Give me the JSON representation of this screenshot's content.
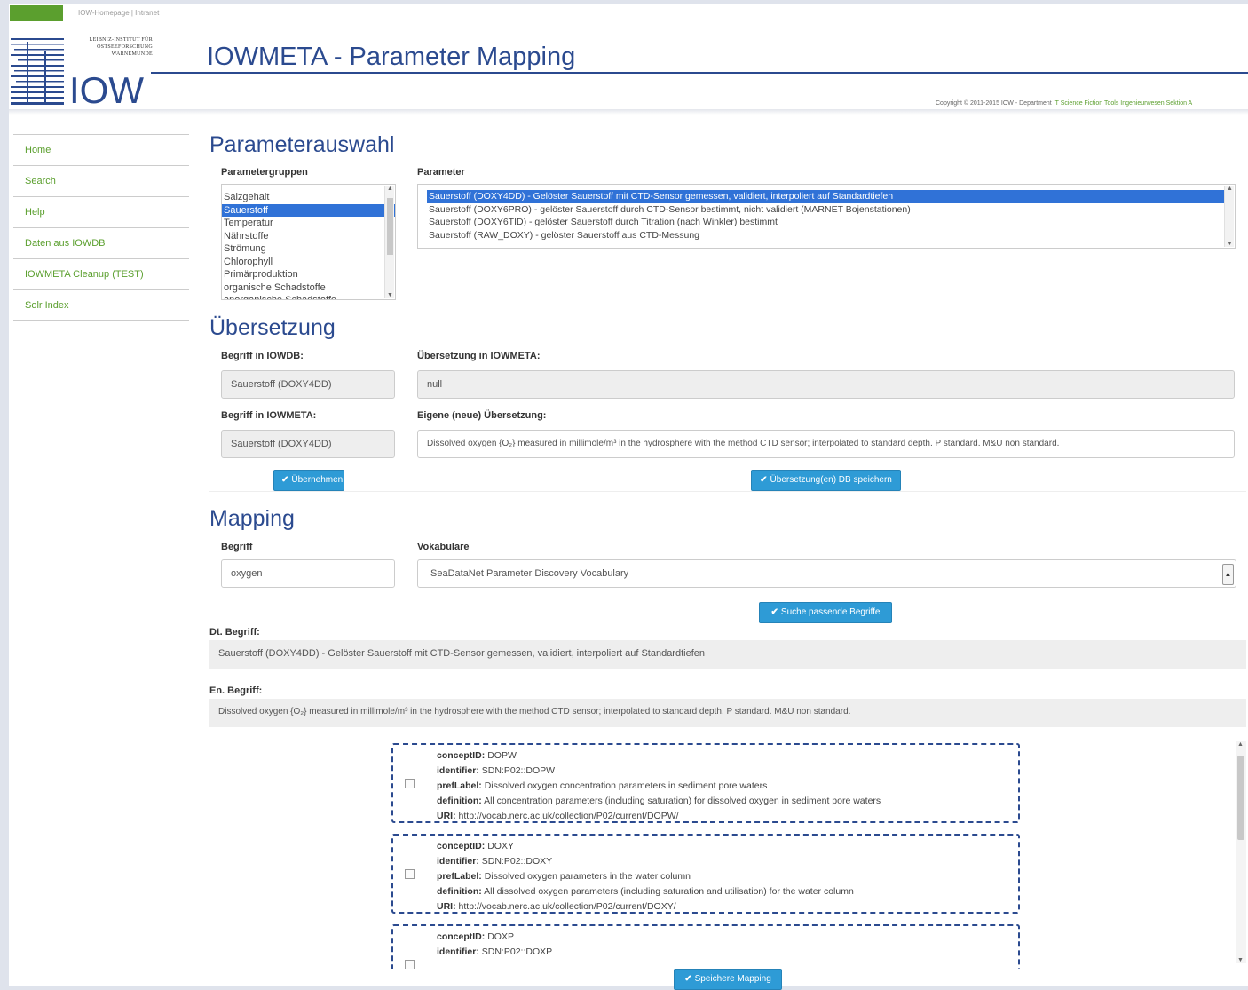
{
  "header": {
    "top_link": "IOW-Homepage | Intranet",
    "logo_lines": [
      "LEIBNIZ-INSTITUT FÜR",
      "OSTSEEFORSCHUNG",
      "WARNEMÜNDE"
    ],
    "logo_mark": "IOW",
    "title": "IOWMETA - Parameter Mapping",
    "copyright_prefix": "Copyright © 2011-2015 IOW - Department ",
    "copyright_links": "IT Science Fiction Tools Ingenieurwesen Sektion A"
  },
  "sidebar": {
    "items": [
      {
        "label": "Home"
      },
      {
        "label": "Search"
      },
      {
        "label": "Help"
      },
      {
        "label": "Daten aus IOWDB"
      },
      {
        "label": "IOWMETA Cleanup (TEST)"
      },
      {
        "label": "Solr Index"
      }
    ]
  },
  "parameterauswahl": {
    "heading": "Parameterauswahl",
    "groups_label": "Parametergruppen",
    "groups": [
      "Salzgehalt",
      "Sauerstoff",
      "Temperatur",
      "Nährstoffe",
      "Strömung",
      "Chlorophyll",
      "Primärproduktion",
      "organische Schadstoffe",
      "anorganische Schadstoffe"
    ],
    "groups_selected": "Sauerstoff",
    "params_label": "Parameter",
    "params": [
      "Sauerstoff (DOXY4DD) - Gelöster Sauerstoff mit CTD-Sensor gemessen, validiert, interpoliert auf Standardtiefen",
      "Sauerstoff (DOXY6PRO) - gelöster Sauerstoff durch CTD-Sensor bestimmt, nicht validiert (MARNET Bojenstationen)",
      "Sauerstoff (DOXY6TID) - gelöster Sauerstoff durch Titration (nach Winkler) bestimmt",
      "Sauerstoff (RAW_DOXY) - gelöster Sauerstoff aus CTD-Messung"
    ],
    "params_selected": "Sauerstoff (DOXY4DD) - Gelöster Sauerstoff mit CTD-Sensor gemessen, validiert, interpoliert auf Standardtiefen"
  },
  "uebersetzung": {
    "heading": "Übersetzung",
    "begriff_iowdb_label": "Begriff in IOWDB:",
    "begriff_iowdb_value": "Sauerstoff (DOXY4DD)",
    "uebersetzung_iowmeta_label": "Übersetzung in IOWMETA:",
    "uebersetzung_iowmeta_value": "null",
    "begriff_iowmeta_label": "Begriff in IOWMETA:",
    "begriff_iowmeta_value": "Sauerstoff (DOXY4DD)",
    "eigene_label": "Eigene (neue) Übersetzung:",
    "eigene_value": "Dissolved oxygen {O₂} measured in millimole/m³ in the hydrosphere with the method CTD sensor; interpolated to standard depth. P standard. M&U non standard.",
    "uebernehmen_button": "Übernehmen",
    "speichern_button": "Übersetzung(en) DB speichern"
  },
  "mapping": {
    "heading": "Mapping",
    "begriff_label": "Begriff",
    "begriff_value": "oxygen",
    "vokabulare_label": "Vokabulare",
    "vokabulare_selected": "SeaDataNet Parameter Discovery Vocabulary",
    "suche_button": "Suche passende Begriffe",
    "de_label": "Dt. Begriff:",
    "de_value": "Sauerstoff (DOXY4DD) - Gelöster Sauerstoff mit CTD-Sensor gemessen, validiert, interpoliert auf Standardtiefen",
    "en_label": "En. Begriff:",
    "en_value": "Dissolved oxygen {O₂} measured in millimole/m³ in the hydrosphere with the method CTD sensor; interpolated to standard depth. P standard. M&U non standard.",
    "save_button": "Speichere Mapping",
    "results": [
      {
        "conceptID": "DOPW",
        "identifier": "SDN:P02::DOPW",
        "prefLabel": "Dissolved oxygen concentration parameters in sediment pore waters",
        "definition": "All concentration parameters (including saturation) for dissolved oxygen in sediment pore waters",
        "URI": "http://vocab.nerc.ac.uk/collection/P02/current/DOPW/"
      },
      {
        "conceptID": "DOXY",
        "identifier": "SDN:P02::DOXY",
        "prefLabel": "Dissolved oxygen parameters in the water column",
        "definition": "All dissolved oxygen parameters (including saturation and utilisation) for the water column",
        "URI": "http://vocab.nerc.ac.uk/collection/P02/current/DOXY/"
      },
      {
        "conceptID": "DOXP",
        "identifier": "SDN:P02::DOXP",
        "prefLabel": "",
        "definition": "",
        "URI": ""
      }
    ],
    "field_labels": {
      "conceptID": "conceptID:",
      "identifier": "identifier:",
      "prefLabel": "prefLabel:",
      "definition": "definition:",
      "URI": "URI:"
    }
  }
}
